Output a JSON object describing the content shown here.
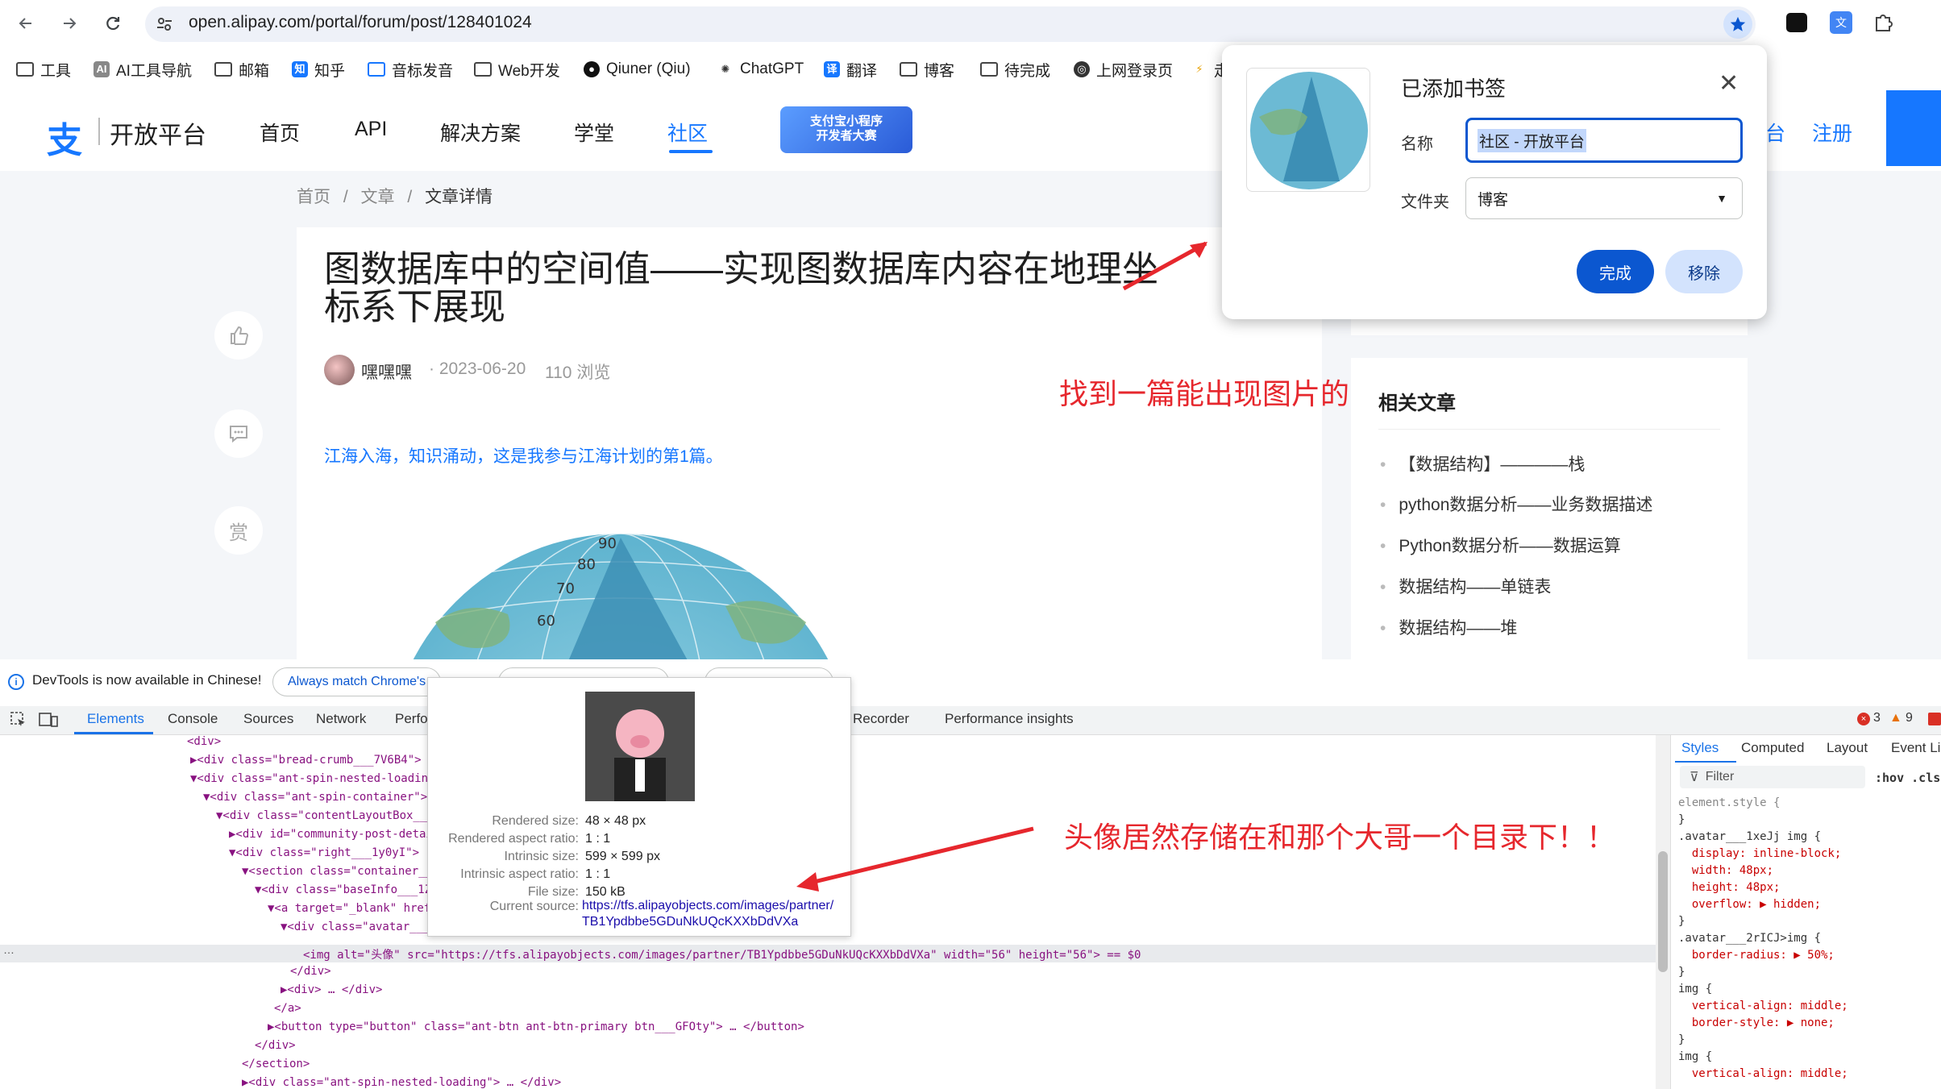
{
  "browser": {
    "url": "open.alipay.com/portal/forum/post/128401024",
    "bookmarks": [
      "工具",
      "AI工具导航",
      "邮箱",
      "知乎",
      "音标发音",
      "Web开发",
      "Qiuner (Qiu)",
      "ChatGPT",
      "翻译",
      "博客",
      "待完成",
      "上网登录页",
      "走"
    ]
  },
  "site": {
    "logo_mark": "支",
    "logo_text": "开放平台",
    "nav": [
      "首页",
      "API",
      "解决方案",
      "学堂",
      "社区"
    ],
    "promo": "支付宝小程序\n开发者大赛",
    "login": "台",
    "register": "注册"
  },
  "breadcrumb": {
    "home": "首页",
    "sep": "/",
    "articles": "文章",
    "current": "文章详情"
  },
  "article": {
    "title": "图数据库中的空间值——实现图数据库内容在地理坐标系下展现",
    "author": "嘿嘿嘿",
    "date": "· 2023-06-20",
    "views": "110 浏览",
    "intro": "江海入海，知识涌动，这是我参与江海计划的第1篇。",
    "reward": "赏",
    "globe_labels": [
      "90",
      "80",
      "70",
      "60"
    ]
  },
  "sidebar": {
    "title": "相关文章",
    "items": [
      "【数据结构】————栈",
      "python数据分析——业务数据描述",
      "Python数据分析——数据运算",
      "数据结构——单链表",
      "数据结构——堆"
    ]
  },
  "annotations": {
    "top": "找到一篇能出现图片的",
    "bottom": "头像居然存储在和那个大哥一个目录下！！"
  },
  "bookmark_popup": {
    "title": "已添加书签",
    "name_label": "名称",
    "name_value": "社区 - 开放平台",
    "folder_label": "文件夹",
    "folder_value": "博客",
    "done": "完成",
    "remove": "移除"
  },
  "devtools": {
    "info": "DevTools is now available in Chinese!",
    "pill1": "Always match Chrome's",
    "tabs": [
      "Elements",
      "Console",
      "Sources",
      "Network",
      "Perfo",
      "Recorder",
      "Performance insights"
    ],
    "errors": "3",
    "warnings": "9",
    "styles_tabs": [
      "Styles",
      "Computed",
      "Layout",
      "Event Li"
    ],
    "filter": "Filter",
    "hov": ":hov .cls",
    "code": [
      "<div>",
      "▶<div class=\"bread-crumb___7V6B4\"> … </div>",
      "▼<div class=\"ant-spin-nested-loading\">",
      "▼<div class=\"ant-spin-container\">",
      "▼<div class=\"contentLayoutBox___",
      "▶<div id=\"community-post-detai",
      "▼<div class=\"right___1y0yI\">",
      "▼<section class=\"container___",
      "▼<div class=\"baseInfo___1Z",
      "▼<a target=\"_blank\" href=",
      "▼<div class=\"avatar___",
      "<img alt=\"头像\" src=\"https://tfs.alipayobjects.com/images/partner/TB1Ypdbbe5GDuNkUQcKXXbDdVXa\" width=\"56\" height=\"56\"> == $0",
      "</div>",
      "▶<div> … </div>",
      "</a>",
      "▶<button type=\"button\" class=\"ant-btn ant-btn-primary btn___GFOty\"> … </button>",
      "</div>",
      "</section>",
      "▶<div class=\"ant-spin-nested-loading\"> … </div>"
    ],
    "css": [
      "element.style {",
      "}",
      ".avatar___1xeJj img {",
      "  display: inline-block;",
      "  width: 48px;",
      "  height: 48px;",
      "  overflow: ▶ hidden;",
      "}",
      ".avatar___2rICJ>img {",
      "  border-radius: ▶ 50%;",
      "}",
      "img {",
      "  vertical-align: middle;",
      "  border-style: ▶ none;",
      "}",
      "img {",
      "  vertical-align: middle;"
    ]
  },
  "tooltip": {
    "rendered_size_k": "Rendered size:",
    "rendered_size": "48 × 48 px",
    "rendered_ratio_k": "Rendered aspect ratio:",
    "rendered_ratio": "1 : 1",
    "intrinsic_size_k": "Intrinsic size:",
    "intrinsic_size": "599 × 599 px",
    "intrinsic_ratio_k": "Intrinsic aspect ratio:",
    "intrinsic_ratio": "1 : 1",
    "file_size_k": "File size:",
    "file_size": "150 kB",
    "source_k": "Current source:",
    "source": "https://tfs.alipayobjects.com/images/partner/TB1Ypdbbe5GDuNkUQcKXXbDdVXa"
  }
}
